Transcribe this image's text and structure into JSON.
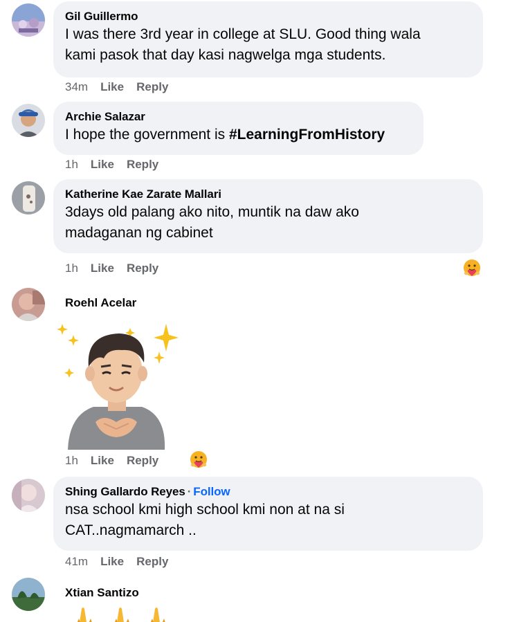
{
  "comments": [
    {
      "author": "Gil Guillermo",
      "line1": "I was there 3rd year in college at SLU. Good thing wala",
      "line2": "kami pasok that day kasi nagwelga mga students.",
      "time": "34m",
      "like": "Like",
      "reply": "Reply"
    },
    {
      "author": "Archie Salazar",
      "text_prefix": "I hope the government is ",
      "hashtag": "#LearningFromHistory",
      "time": "1h",
      "like": "Like",
      "reply": "Reply"
    },
    {
      "author": "Katherine Kae Zarate Mallari",
      "line1": "3days old palang ako nito, muntik na daw ako",
      "line2": "madaganan ng cabinet",
      "time": "1h",
      "like": "Like",
      "reply": "Reply",
      "reaction": "care-reaction-icon"
    },
    {
      "author": "Roehl Acelar",
      "attachment": "avatar-sticker",
      "time": "1h",
      "like": "Like",
      "reply": "Reply",
      "reaction": "care-reaction-icon"
    },
    {
      "author": "Shing Gallardo Reyes",
      "separator": "·",
      "follow": "Follow",
      "line1": "nsa school kmi high school kmi non at na si",
      "line2": "CAT..nagmamarch ..",
      "time": "41m",
      "like": "Like",
      "reply": "Reply"
    },
    {
      "author": "Xtian Santizo",
      "attachment": "folded-hands-emoji"
    }
  ],
  "colors": {
    "bubble": "#f0f2f5",
    "secondary_text": "#65676b",
    "link": "#0866ff"
  }
}
